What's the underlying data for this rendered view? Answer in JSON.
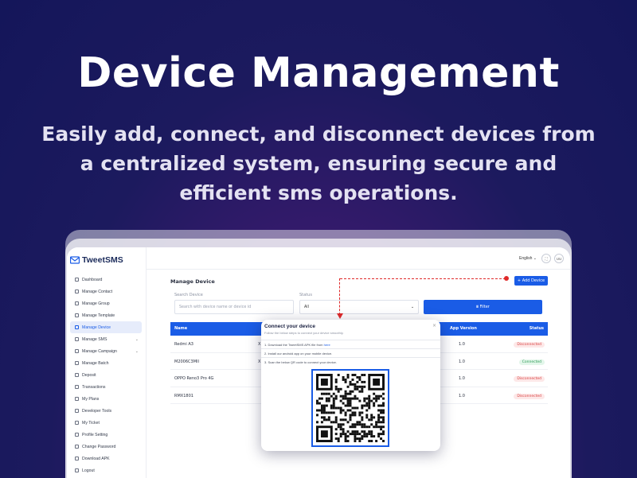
{
  "hero": {
    "title": "Device Management",
    "subtitle": "Easily add, connect, and disconnect devices from a centralized system, ensuring secure and efficient sms operations."
  },
  "app": {
    "brand": "TweetSMS",
    "language": "English",
    "user_initials": "UU",
    "nav": [
      {
        "label": "Dashboard",
        "icon": "home-icon"
      },
      {
        "label": "Manage Contact",
        "icon": "contact-icon"
      },
      {
        "label": "Manage Group",
        "icon": "group-icon"
      },
      {
        "label": "Manage Template",
        "icon": "template-icon"
      },
      {
        "label": "Manage Device",
        "icon": "device-icon",
        "active": true
      },
      {
        "label": "Manage SMS",
        "icon": "sms-icon",
        "expandable": true
      },
      {
        "label": "Manage Campaign",
        "icon": "campaign-icon",
        "expandable": true
      },
      {
        "label": "Manage Batch",
        "icon": "batch-icon"
      },
      {
        "label": "Deposit",
        "icon": "deposit-icon"
      },
      {
        "label": "Transactions",
        "icon": "transactions-icon"
      },
      {
        "label": "My Plans",
        "icon": "plans-icon"
      },
      {
        "label": "Developer Tools",
        "icon": "code-icon"
      },
      {
        "label": "My Ticket",
        "icon": "ticket-icon"
      },
      {
        "label": "Profile Setting",
        "icon": "profile-icon"
      },
      {
        "label": "Change Password",
        "icon": "lock-icon"
      },
      {
        "label": "Download APK",
        "icon": "download-icon"
      },
      {
        "label": "Logout",
        "icon": "logout-icon"
      }
    ],
    "page_title": "Manage Device",
    "add_button": "+ Add Device",
    "filter": {
      "search_label": "Search Device",
      "search_placeholder": "Search with device name or device id",
      "status_label": "Status",
      "status_value": "All",
      "button": "Filter"
    },
    "table": {
      "headers": {
        "name": "Name",
        "app_version": "App Version",
        "status": "Status"
      },
      "rows": [
        {
          "name": "Redmi A3",
          "prefix": "X",
          "version": "1.0",
          "status": "Disconnected",
          "tone": "red"
        },
        {
          "name": "M2006C3MII",
          "prefix": "X",
          "version": "1.0",
          "status": "Connected",
          "tone": "green"
        },
        {
          "name": "OPPO Reno3 Pro 4G",
          "prefix": "",
          "version": "1.0",
          "status": "Disconnected",
          "tone": "red"
        },
        {
          "name": "RMX1801",
          "prefix": "",
          "version": "1.0",
          "status": "Disconnected",
          "tone": "red"
        }
      ]
    }
  },
  "modal": {
    "title": "Connect your device",
    "subtitle": "Follow the below steps to connect your device smoothly.",
    "step1": "1. Download the TweetSMS APK file from",
    "step1_link": "here",
    "step2": "2. Install our android app on your mobile device.",
    "step3": "3. Scan the below QR code to connect your device.",
    "close": "×"
  },
  "colors": {
    "accent": "#1a5ce6",
    "annotation": "#e02a2a"
  }
}
